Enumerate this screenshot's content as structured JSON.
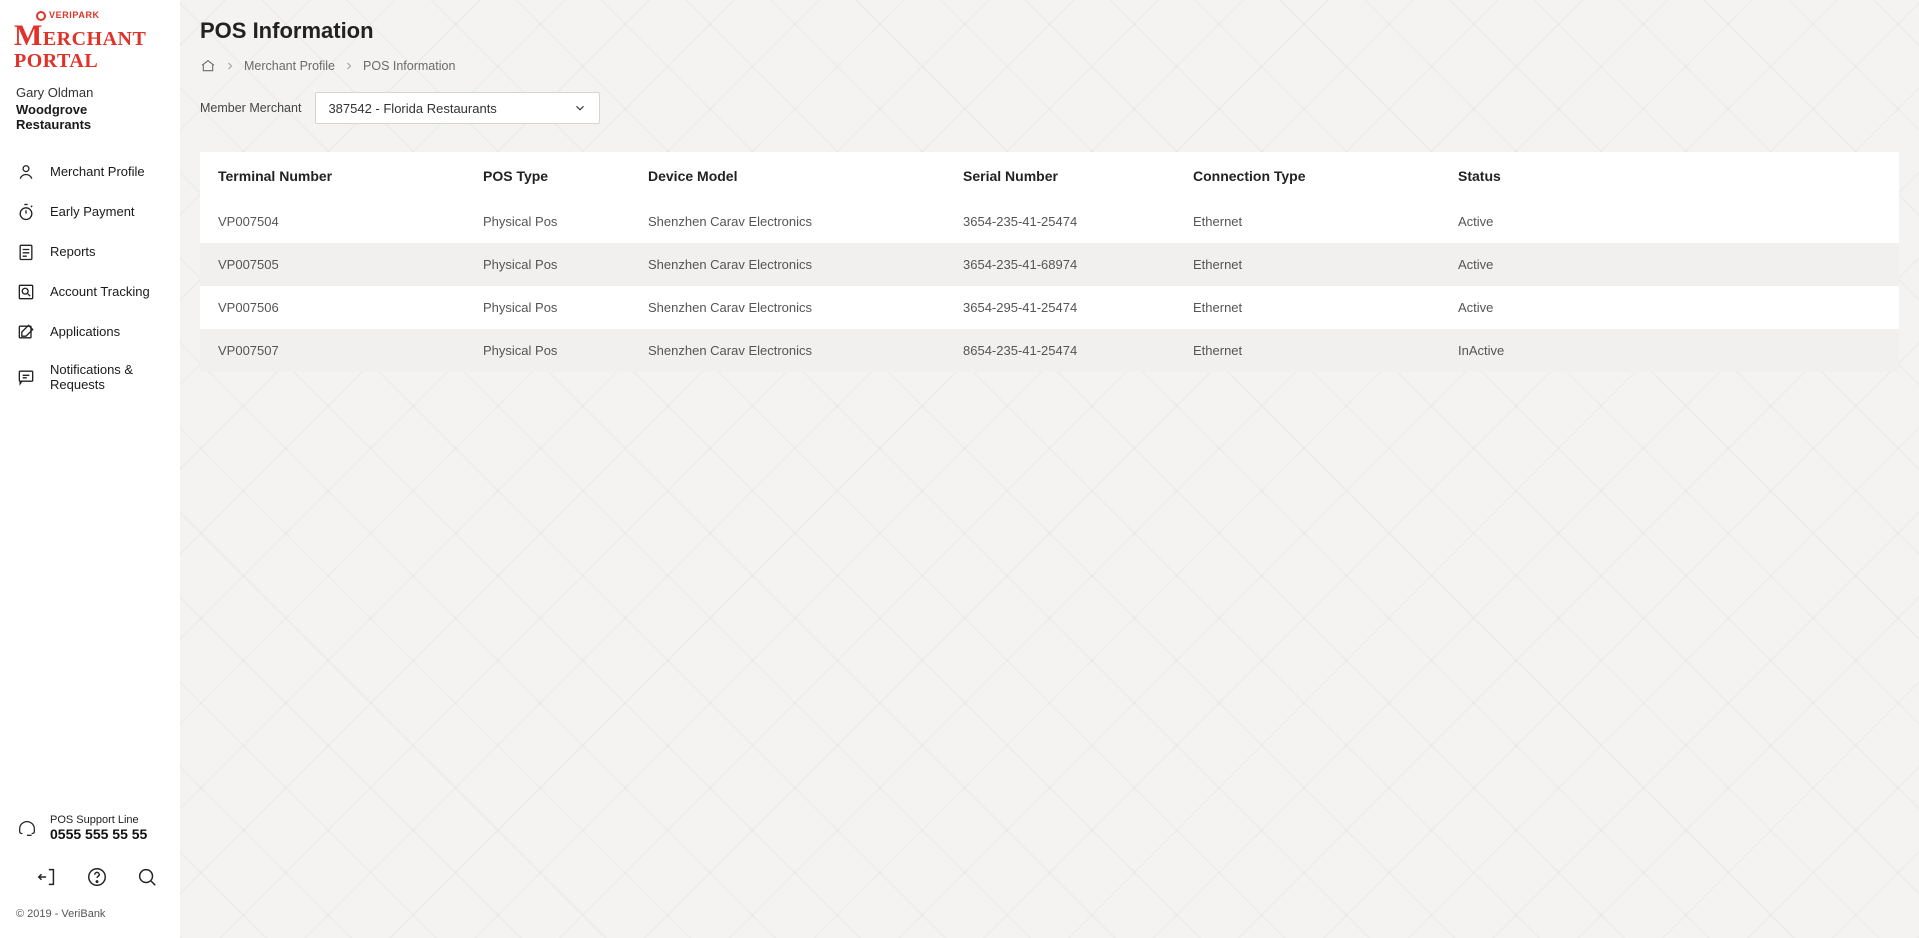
{
  "brand": {
    "top": "VERIPARK",
    "main": "ERCHANT PORTAL"
  },
  "user": {
    "name": "Gary Oldman",
    "org": "Woodgrove Restaurants"
  },
  "nav": [
    {
      "key": "profile",
      "label": "Merchant Profile"
    },
    {
      "key": "early",
      "label": "Early Payment"
    },
    {
      "key": "reports",
      "label": "Reports"
    },
    {
      "key": "tracking",
      "label": "Account Tracking"
    },
    {
      "key": "apps",
      "label": "Applications"
    },
    {
      "key": "notif",
      "label": "Notifications & Requests"
    }
  ],
  "support": {
    "label": "POS Support Line",
    "number": "0555 555 55 55"
  },
  "copyright": "© 2019 - VeriBank",
  "page": {
    "title": "POS Information",
    "breadcrumb": {
      "l1": "Merchant Profile",
      "l2": "POS Information"
    },
    "filter": {
      "label": "Member Merchant",
      "value": "387542 - Florida Restaurants"
    }
  },
  "table": {
    "headers": {
      "term": "Terminal Number",
      "type": "POS Type",
      "model": "Device Model",
      "serial": "Serial Number",
      "conn": "Connection Type",
      "status": "Status"
    },
    "rows": [
      {
        "term": "VP007504",
        "type": "Physical Pos",
        "model": "Shenzhen Carav Electronics",
        "serial": "3654-235-41-25474",
        "conn": "Ethernet",
        "status": "Active"
      },
      {
        "term": "VP007505",
        "type": "Physical Pos",
        "model": "Shenzhen Carav Electronics",
        "serial": "3654-235-41-68974",
        "conn": "Ethernet",
        "status": "Active"
      },
      {
        "term": "VP007506",
        "type": "Physical Pos",
        "model": "Shenzhen Carav Electronics",
        "serial": "3654-295-41-25474",
        "conn": "Ethernet",
        "status": "Active"
      },
      {
        "term": "VP007507",
        "type": "Physical Pos",
        "model": "Shenzhen Carav Electronics",
        "serial": "8654-235-41-25474",
        "conn": "Ethernet",
        "status": "InActive"
      }
    ]
  }
}
